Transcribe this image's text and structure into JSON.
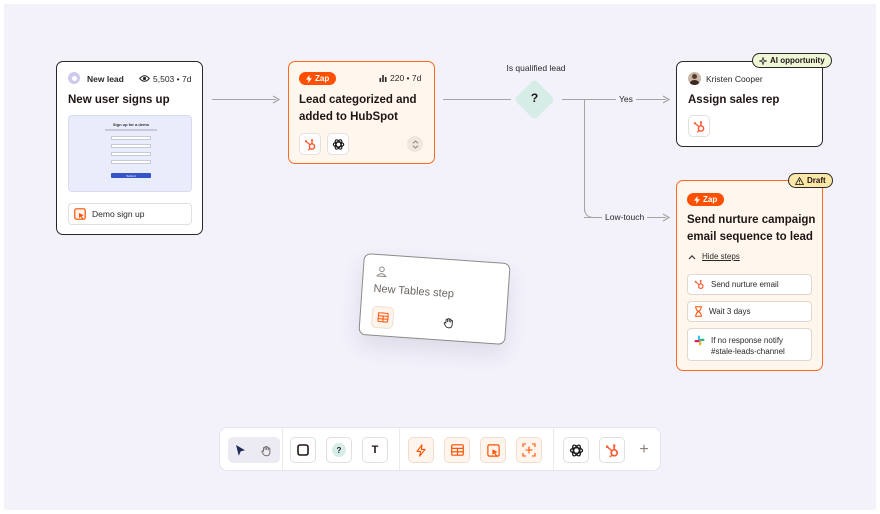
{
  "colors": {
    "canvas": "#f3f2fb",
    "accent": "#ff4f00",
    "ink": "#2b2727",
    "decision": "#d5ede6",
    "ai_tag": "#eef7d6",
    "draft_tag": "#fbe8a6"
  },
  "card_new_lead": {
    "source_label": "New lead",
    "stats": "5,503 • 7d",
    "title": "New user signs up",
    "preview_form": {
      "heading": "Sign up for a demo",
      "button": "Submit"
    },
    "app_label": "Demo sign up"
  },
  "card_hubspot": {
    "badge": "Zap",
    "stats": "220 • 7d",
    "title": "Lead categorized and added to HubSpot",
    "icons": [
      "hubspot-icon",
      "openai-icon"
    ]
  },
  "decision": {
    "label": "Is qualified lead",
    "symbol": "?",
    "branch_yes": "Yes",
    "branch_low": "Low-touch"
  },
  "card_assign": {
    "tag": "AI opportunity",
    "person": "Kristen Cooper",
    "title": "Assign sales rep"
  },
  "card_nurture": {
    "tag": "Draft",
    "badge": "Zap",
    "title": "Send nurture campaign email sequence to lead",
    "toggle_label": "Hide steps",
    "steps": [
      {
        "icon": "hubspot-icon",
        "label": "Send nurture email"
      },
      {
        "icon": "hourglass-icon",
        "label": "Wait 3 days"
      },
      {
        "icon": "slack-icon",
        "label": "If no response notify #stale-leads-channel"
      }
    ]
  },
  "card_tables": {
    "title": "New Tables step"
  },
  "toolbar": {
    "tools": [
      "select-pointer",
      "pan-hand",
      "rectangle",
      "decision",
      "text",
      "zap",
      "table",
      "interface",
      "canvas-embed",
      "chatgpt",
      "hubspot",
      "add"
    ],
    "decision_symbol": "?",
    "text_symbol": "T",
    "add_symbol": "+"
  }
}
